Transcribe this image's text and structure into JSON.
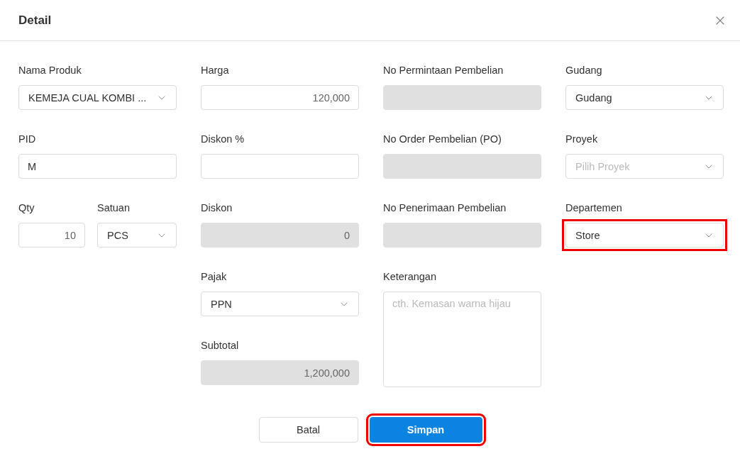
{
  "dialog": {
    "title": "Detail"
  },
  "columns": [
    [
      {
        "kind": "select",
        "label": "Nama Produk",
        "value": "KEMEJA CUAL KOMBI ...",
        "disabled": false,
        "highlighted": false
      },
      {
        "kind": "text",
        "label": "PID",
        "value": "M",
        "disabled": false,
        "highlighted": false
      },
      {
        "kind": "pair",
        "children": [
          {
            "kind": "number",
            "label": "Qty",
            "value": "10",
            "disabled": false,
            "highlighted": false
          },
          {
            "kind": "select",
            "label": "Satuan",
            "value": "PCS",
            "disabled": false,
            "highlighted": false
          }
        ]
      }
    ],
    [
      {
        "kind": "number",
        "label": "Harga",
        "value": "120,000",
        "disabled": false,
        "highlighted": false
      },
      {
        "kind": "number",
        "label": "Diskon %",
        "disabled": false,
        "highlighted": false
      },
      {
        "kind": "number",
        "label": "Diskon",
        "value": "0",
        "disabled": true,
        "highlighted": false
      },
      {
        "kind": "select",
        "label": "Pajak",
        "value": "PPN",
        "disabled": false,
        "highlighted": false
      },
      {
        "kind": "number",
        "label": "Subtotal",
        "value": "1,200,000",
        "disabled": true,
        "highlighted": false
      }
    ],
    [
      {
        "kind": "text",
        "label": "No Permintaan Pembelian",
        "disabled": true,
        "highlighted": false
      },
      {
        "kind": "text",
        "label": "No Order Pembelian (PO)",
        "disabled": true,
        "highlighted": false
      },
      {
        "kind": "text",
        "label": "No Penerimaan Pembelian",
        "disabled": true,
        "highlighted": false
      },
      {
        "kind": "textarea",
        "label": "Keterangan",
        "placeholder": "cth. Kemasan warna hijau",
        "disabled": false,
        "highlighted": false
      }
    ],
    [
      {
        "kind": "select",
        "label": "Gudang",
        "value": "Gudang",
        "disabled": false,
        "highlighted": false
      },
      {
        "kind": "select",
        "label": "Proyek",
        "placeholder": "Pilih Proyek",
        "disabled": false,
        "highlighted": false
      },
      {
        "kind": "select",
        "label": "Departemen",
        "value": "Store",
        "disabled": false,
        "highlighted": true
      }
    ]
  ],
  "buttons": [
    {
      "kind": "secondary",
      "label": "Batal",
      "highlighted": false
    },
    {
      "kind": "primary",
      "label": "Simpan",
      "highlighted": true
    }
  ]
}
